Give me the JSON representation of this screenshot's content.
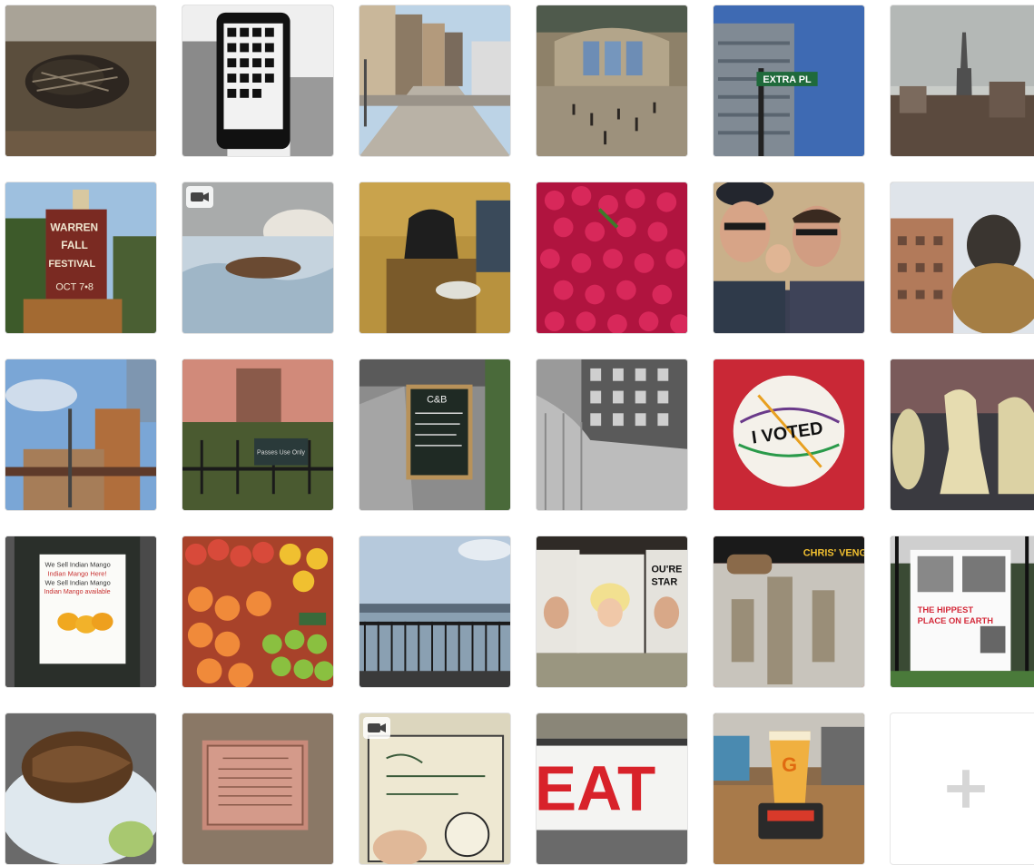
{
  "grid": {
    "tiles": [
      {
        "name": "photo-porcupine",
        "has_video": false
      },
      {
        "name": "photo-phone-drawing",
        "has_video": false
      },
      {
        "name": "photo-city-street",
        "has_video": false
      },
      {
        "name": "photo-grand-central",
        "has_video": false
      },
      {
        "name": "photo-extra-place-sign",
        "has_video": false
      },
      {
        "name": "photo-empire-state-skyline",
        "has_video": false
      },
      {
        "name": "photo-warren-fall-festival",
        "has_video": false
      },
      {
        "name": "video-dog-on-bed",
        "has_video": true
      },
      {
        "name": "photo-darth-vader-figure",
        "has_video": false
      },
      {
        "name": "photo-radishes",
        "has_video": false
      },
      {
        "name": "photo-selfie",
        "has_video": false
      },
      {
        "name": "photo-hippo-statue",
        "has_video": false
      },
      {
        "name": "photo-elevated-tracks",
        "has_video": false
      },
      {
        "name": "photo-park-fence",
        "has_video": false
      },
      {
        "name": "photo-chalkboard-sign",
        "has_video": false
      },
      {
        "name": "photo-building-facade",
        "has_video": false
      },
      {
        "name": "photo-i-voted-sticker",
        "has_video": false
      },
      {
        "name": "photo-chess-pieces",
        "has_video": false
      },
      {
        "name": "photo-mango-sign",
        "has_video": false
      },
      {
        "name": "photo-fruit-stand",
        "has_video": false
      },
      {
        "name": "photo-river-sunset",
        "has_video": false
      },
      {
        "name": "photo-portrait-posters",
        "has_video": false
      },
      {
        "name": "photo-mural-shop",
        "has_video": false
      },
      {
        "name": "photo-hippest-place-poster",
        "has_video": false
      },
      {
        "name": "photo-food-plate",
        "has_video": false
      },
      {
        "name": "photo-bronze-plaque",
        "has_video": false
      },
      {
        "name": "video-dollar-bill",
        "has_video": true
      },
      {
        "name": "photo-eat-sign",
        "has_video": false
      },
      {
        "name": "photo-beer-glass",
        "has_video": false
      }
    ],
    "add_button": {
      "icon": "plus-icon"
    }
  },
  "text": {
    "warren": "WARREN",
    "fall": "FALL",
    "festival": "FESTIVAL",
    "oct": "OCT 7•8",
    "extra_pl": "EXTRA PL",
    "cb": "C&B",
    "voted": "I VOTED",
    "mango1": "We Sell Indian Mango",
    "mango2": "Indian Mango Here!",
    "mango3": "We Sell Indian Mango",
    "mango4": "Indian Mango available",
    "hippest1": "THE HIPPEST",
    "hippest2": "PLACE ON EARTH",
    "eat": "EAT",
    "g": "G",
    "chris": "CHRIS' VENG",
    "star": "STAR",
    "youre": "OU'RE",
    "passes": "Passes Use Only"
  },
  "colors": {
    "tile_border": "#e3e3e3",
    "plus": "#d6d6d6"
  }
}
